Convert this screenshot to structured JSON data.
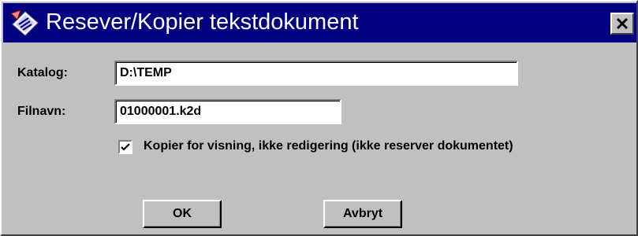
{
  "window": {
    "title": "Resever/Kopier tekstdokument",
    "close_label": "close"
  },
  "form": {
    "katalog_label": "Katalog:",
    "katalog_value": "D:\\TEMP",
    "filnavn_label": "Filnavn:",
    "filnavn_value": "01000001.k2d",
    "copy_checkbox": {
      "checked": true,
      "label": "Kopier for visning, ikke redigering (ikke reserver dokumentet)"
    }
  },
  "buttons": {
    "ok": "OK",
    "cancel": "Avbryt"
  },
  "colors": {
    "titlebar": "#000080",
    "face": "#c0c0c0"
  },
  "icons": {
    "title": "document-icon",
    "close": "close-icon",
    "check": "checkmark-icon"
  }
}
